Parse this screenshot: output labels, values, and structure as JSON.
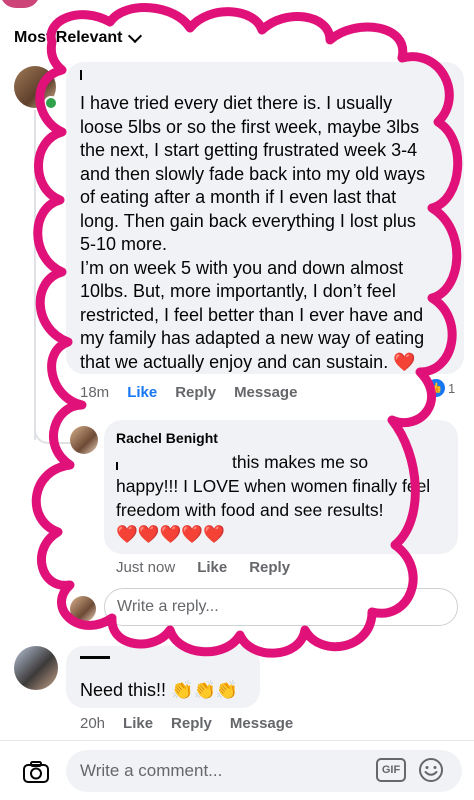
{
  "sort": {
    "label": "Most Relevant"
  },
  "comments": [
    {
      "author": "",
      "text_lines": [
        "I have tried every diet there is. I usually",
        "loose 5lbs or so the first week, maybe 3lbs",
        "the next, I start getting frustrated week 3-4",
        "and then slowly fade back into my old ways",
        "of eating after a month if I even last that",
        "long. Then gain back everything I lost plus",
        "5-10 more.",
        "I’m on week 5 with you and down almost",
        "10lbs. But, more importantly, I don’t feel",
        "restricted, I feel better than I ever have and",
        "my family has adapted a new way of eating",
        "that we actually enjoy and can sustain. ❤️"
      ],
      "time": "18m",
      "like": "Like",
      "reply": "Reply",
      "message": "Message",
      "reaction_count": "1"
    },
    {
      "author": "Rachel Benight",
      "text_lines": [
        "this makes me so",
        "happy!!! I LOVE when women finally feel",
        "freedom with food and see results!",
        "❤️❤️❤️❤️❤️"
      ],
      "time": "Just now",
      "like": "Like",
      "reply": "Reply"
    },
    {
      "author": "",
      "text": "Need this!! 👏👏👏",
      "time": "20h",
      "like": "Like",
      "reply": "Reply",
      "message": "Message"
    }
  ],
  "reply_box": {
    "placeholder": "Write a reply..."
  },
  "comment_box": {
    "placeholder": "Write a comment..."
  },
  "gif_label": "GIF",
  "colors": {
    "annotation": "#e0127a",
    "online": "#31a24c",
    "link": "#1877f2"
  }
}
